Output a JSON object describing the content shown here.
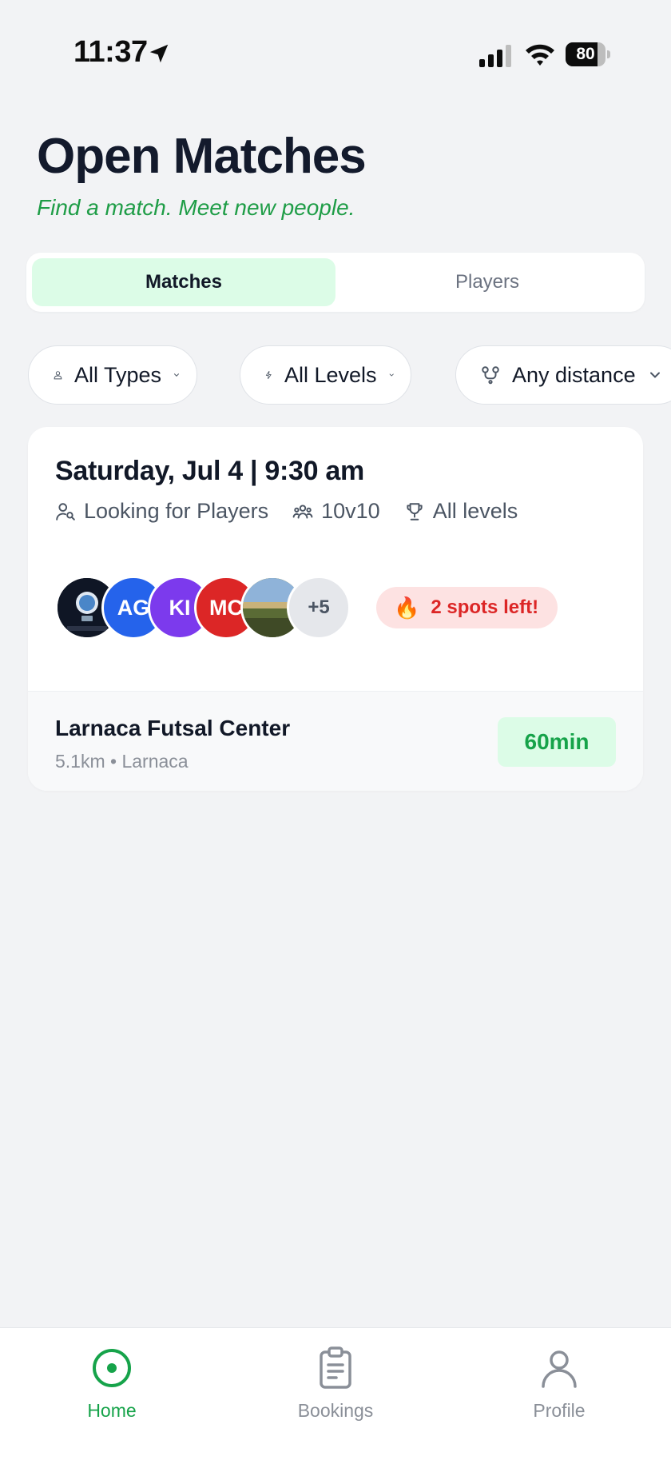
{
  "status_bar": {
    "time": "11:37",
    "battery": "80",
    "battery_level": 0.8
  },
  "header": {
    "title": "Open Matches",
    "subtitle": "Find a match. Meet new people."
  },
  "tabs": [
    {
      "label": "Matches",
      "active": true
    },
    {
      "label": "Players",
      "active": false
    }
  ],
  "filters": [
    {
      "label": "All Types",
      "icon": "person-icon"
    },
    {
      "label": "All Levels",
      "icon": "bolt-icon"
    },
    {
      "label": "Any distance",
      "icon": "route-icon"
    }
  ],
  "match": {
    "date": "Saturday, Jul 4 | 9:30 am",
    "meta": [
      {
        "label": "Looking for Players",
        "icon": "person-search-icon"
      },
      {
        "label": "10v10",
        "icon": "group-icon"
      },
      {
        "label": "All levels",
        "icon": "trophy-icon"
      }
    ],
    "avatars": [
      {
        "type": "photo",
        "name": "avatar-photo-logo",
        "color": "#0f1625"
      },
      {
        "type": "initials",
        "initials": "AG",
        "color": "#2563eb"
      },
      {
        "type": "initials",
        "initials": "KI",
        "color": "#7c3aed"
      },
      {
        "type": "initials",
        "initials": "MC",
        "color": "#dc2626"
      },
      {
        "type": "photo",
        "name": "avatar-photo-field",
        "color": "#6b7c4a"
      }
    ],
    "more_count": "+5",
    "spots_left": "2 spots left!",
    "venue": "Larnaca Futsal Center",
    "venue_details": "5.1km • Larnaca",
    "duration": "60min"
  },
  "nav": [
    {
      "label": "Home",
      "icon": "home-icon",
      "active": true
    },
    {
      "label": "Bookings",
      "icon": "clipboard-icon",
      "active": false
    },
    {
      "label": "Profile",
      "icon": "user-icon",
      "active": false
    }
  ],
  "colors": {
    "accent": "#16a34a",
    "accent_light": "#dcfce7",
    "danger": "#dc2626",
    "danger_light": "#fde2e2",
    "background": "#f2f3f5"
  }
}
